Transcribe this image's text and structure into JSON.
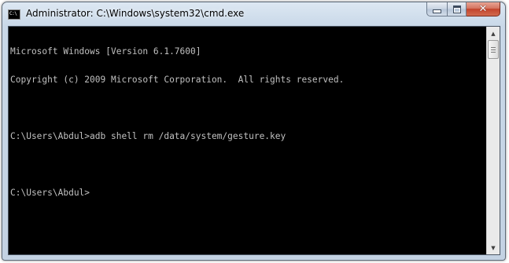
{
  "window": {
    "title": "Administrator: C:\\Windows\\system32\\cmd.exe",
    "icon": "cmd-icon",
    "icon_text": "C:\\"
  },
  "caption_buttons": {
    "minimize_icon": "minimize-icon",
    "maximize_icon": "maximize-icon",
    "close_icon": "close-icon",
    "close_glyph": "✕",
    "close_color": "#c2432b"
  },
  "console": {
    "background": "#000000",
    "foreground": "#c0c0c0",
    "lines": [
      "Microsoft Windows [Version 6.1.7600]",
      "Copyright (c) 2009 Microsoft Corporation.  All rights reserved.",
      "",
      "C:\\Users\\Abdul>adb shell rm /data/system/gesture.key",
      "",
      "C:\\Users\\Abdul>"
    ]
  },
  "scrollbar": {
    "up_glyph": "▲",
    "down_glyph": "▼",
    "scroll_position": 0
  }
}
